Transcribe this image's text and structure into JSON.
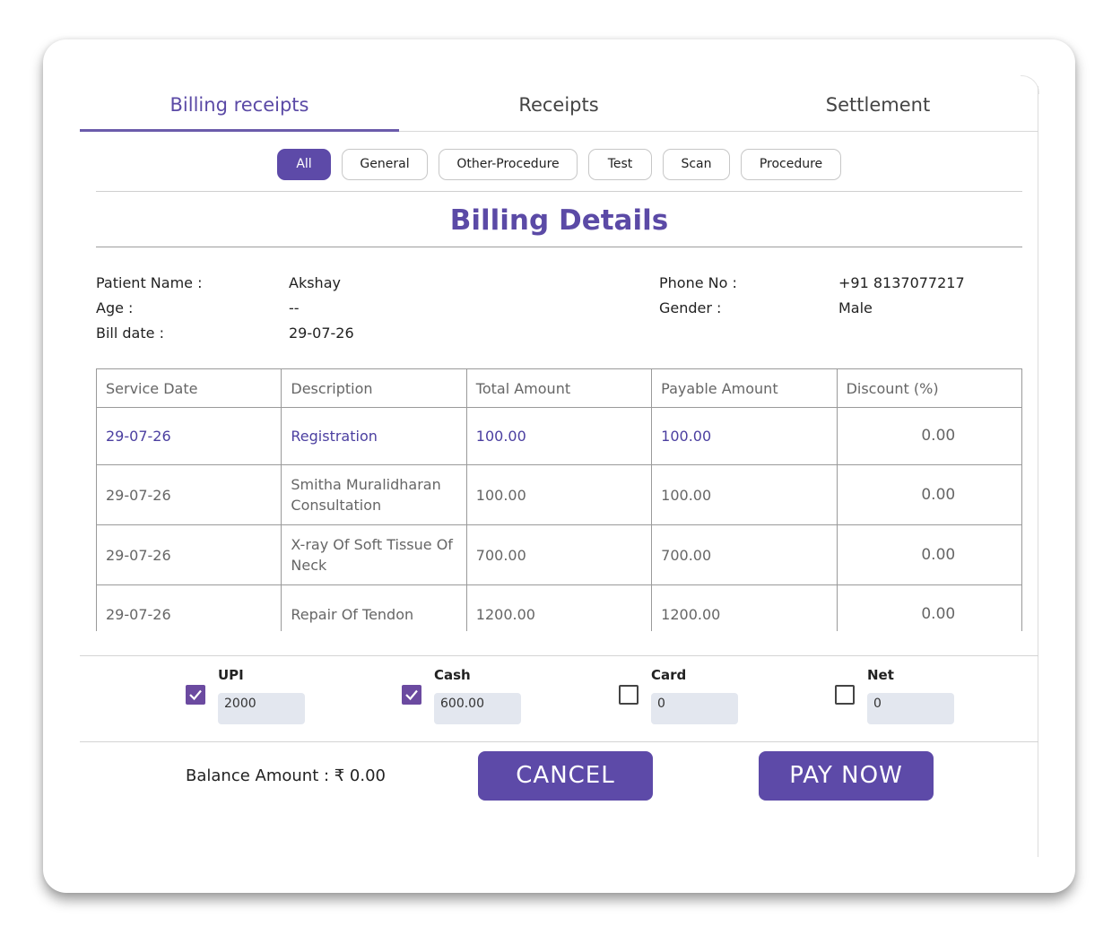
{
  "tabs": [
    {
      "label": "Billing receipts",
      "active": true
    },
    {
      "label": "Receipts",
      "active": false
    },
    {
      "label": "Settlement",
      "active": false
    }
  ],
  "filters": [
    {
      "label": "All",
      "active": true
    },
    {
      "label": "General",
      "active": false
    },
    {
      "label": "Other-Procedure",
      "active": false
    },
    {
      "label": "Test",
      "active": false
    },
    {
      "label": "Scan",
      "active": false
    },
    {
      "label": "Procedure",
      "active": false
    }
  ],
  "title": "Billing Details",
  "patient": {
    "name_label": "Patient Name :",
    "name": "Akshay",
    "age_label": "Age :",
    "age": "--",
    "bill_date_label": "Bill date :",
    "bill_date": "29-07-26",
    "phone_label": "Phone No :",
    "phone": "+91 8137077217",
    "gender_label": "Gender :",
    "gender": "Male"
  },
  "table": {
    "headers": [
      "Service Date",
      "Description",
      "Total Amount",
      "Payable Amount",
      "Discount (%)"
    ],
    "rows": [
      [
        "29-07-26",
        "Registration",
        "100.00",
        "100.00",
        "0.00"
      ],
      [
        "29-07-26",
        "Smitha Muralidharan Consultation",
        "100.00",
        "100.00",
        "0.00"
      ],
      [
        "29-07-26",
        "X-ray Of Soft Tissue Of Neck",
        "700.00",
        "700.00",
        "0.00"
      ],
      [
        "29-07-26",
        "Repair Of Tendon",
        "1200.00",
        "1200.00",
        "0.00"
      ]
    ]
  },
  "payment": {
    "methods": [
      {
        "label": "UPI",
        "checked": true,
        "value": "2000"
      },
      {
        "label": "Cash",
        "checked": true,
        "value": "600.00"
      },
      {
        "label": "Card",
        "checked": false,
        "value": "0"
      },
      {
        "label": "Net",
        "checked": false,
        "value": "0"
      }
    ],
    "balance": "Balance Amount : ₹ 0.00"
  },
  "buttons": {
    "cancel": "CANCEL",
    "pay": "PAY NOW"
  },
  "colors": {
    "accent": "#5d4aa8",
    "tab_active": "#5b4aa6",
    "input_bg": "#e3e7ef"
  }
}
